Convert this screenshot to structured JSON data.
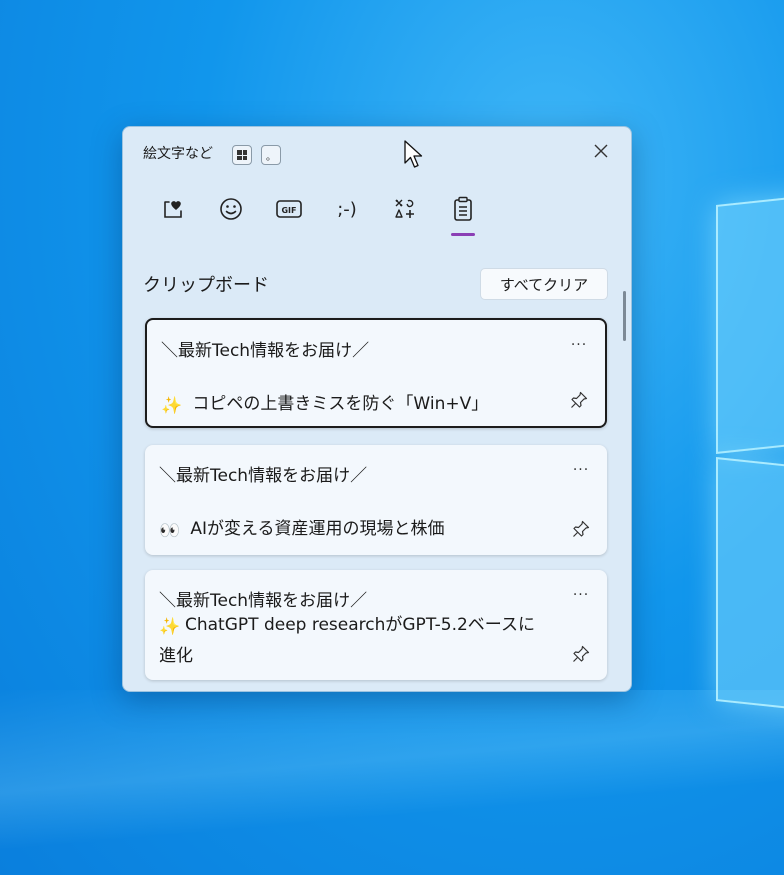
{
  "window": {
    "title": "絵文字など",
    "shortcut_dot": "。"
  },
  "tabs": [
    {
      "name": "kaomoji-favorites",
      "label": ""
    },
    {
      "name": "emoji",
      "label": ""
    },
    {
      "name": "gif",
      "label": "GIF"
    },
    {
      "name": "kaomoji",
      "label": ";-)"
    },
    {
      "name": "symbols",
      "label": ""
    },
    {
      "name": "clipboard",
      "label": ""
    }
  ],
  "tab_gif_label": "GIF",
  "tab_kaomoji_label": ";-)",
  "active_tab": "clipboard",
  "clipboard": {
    "title": "クリップボード",
    "clear_all_label": "すべてクリア",
    "items": [
      {
        "line1": "＼最新Tech情報をお届け／",
        "emoji": "✨",
        "text": "コピペの上書きミスを防ぐ「Win+V」",
        "selected": true
      },
      {
        "line1": "＼最新Tech情報をお届け／",
        "emoji": "👀",
        "text": "AIが変える資産運用の現場と株価",
        "selected": false
      },
      {
        "line1": "＼最新Tech情報をお届け／",
        "emoji": "✨",
        "text": "ChatGPT deep researchがGPT-5.2ベースに進化",
        "selected": false
      }
    ],
    "more_label": "···"
  },
  "colors": {
    "accent": "#8b3fb5",
    "panel_bg": "#dbeaf7",
    "card_bg": "#f3f8fd",
    "desktop_bg": "#1196ec"
  },
  "icons": [
    "windows-key-icon",
    "close-icon",
    "heart-sticker-icon",
    "smiley-icon",
    "gif-icon",
    "kaomoji-icon",
    "symbols-icon",
    "clipboard-icon",
    "more-icon",
    "pin-icon",
    "cursor-arrow-icon"
  ]
}
